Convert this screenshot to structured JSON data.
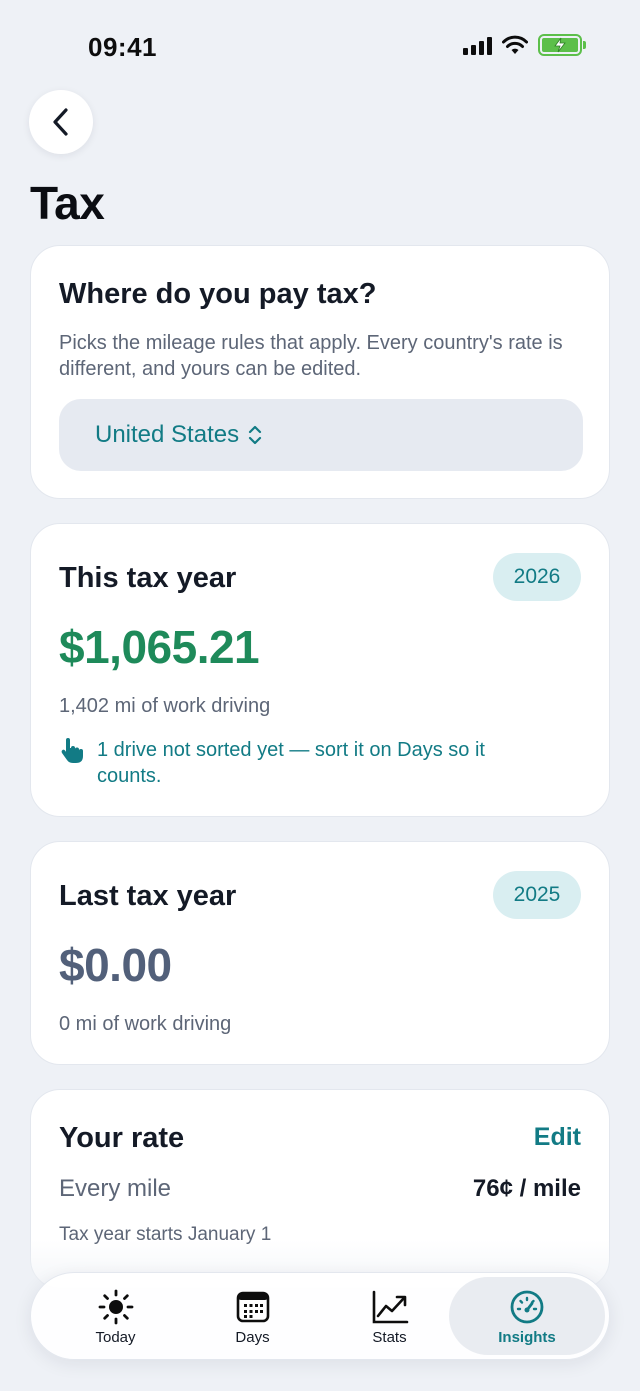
{
  "status": {
    "time": "09:41"
  },
  "page": {
    "title": "Tax"
  },
  "country_card": {
    "title": "Where do you pay tax?",
    "description": "Picks the mileage rules that apply. Every country's rate is different, and yours can be edited.",
    "selected_country": "United States"
  },
  "this_year": {
    "title": "This tax year",
    "year": "2026",
    "amount": "$1,065.21",
    "miles": "1,402 mi of work driving",
    "unsorted_notice": "1 drive not sorted yet — sort it on Days so it counts."
  },
  "last_year": {
    "title": "Last tax year",
    "year": "2025",
    "amount": "$0.00",
    "miles": "0 mi of work driving"
  },
  "rate": {
    "title": "Your rate",
    "edit_label": "Edit",
    "label": "Every mile",
    "value": "76¢ / mile",
    "year_start": "Tax year starts January 1"
  },
  "tab_bar": {
    "tabs": [
      {
        "label": "Today",
        "icon": "sun-icon"
      },
      {
        "label": "Days",
        "icon": "calendar-icon"
      },
      {
        "label": "Stats",
        "icon": "chart-icon"
      },
      {
        "label": "Insights",
        "icon": "gauge-icon"
      }
    ],
    "active": "Insights"
  },
  "colors": {
    "accent": "#127b85",
    "positive": "#1e8a5a",
    "background": "#eef1f6"
  }
}
